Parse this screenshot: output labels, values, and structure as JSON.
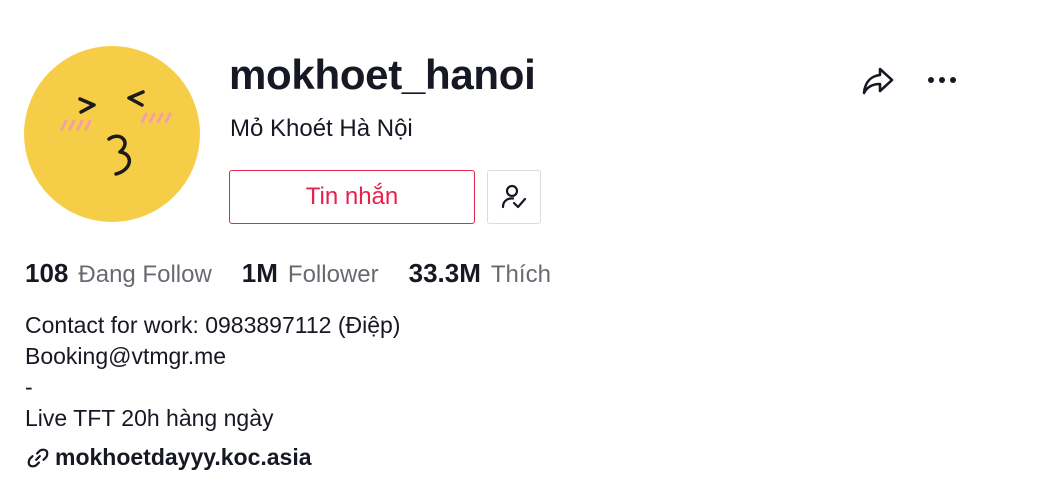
{
  "profile": {
    "username": "mokhoet_hanoi",
    "nickname": "Mỏ Khoét Hà Nội",
    "avatar_color": "#f6cd46"
  },
  "actions": {
    "message_label": "Tin nhắn",
    "accent_color": "#e8214b",
    "follow_icon": "user-check-icon",
    "share_icon": "share-icon",
    "more_icon": "more-dots-icon"
  },
  "stats": [
    {
      "value": "108",
      "label": "Đang Follow"
    },
    {
      "value": "1M",
      "label": "Follower"
    },
    {
      "value": "33.3M",
      "label": "Thích"
    }
  ],
  "bio": {
    "lines": [
      "Contact for work: 0983897112 (Điệp)",
      "Booking@vtmgr.me",
      "-",
      "Live TFT 20h hàng ngày"
    ]
  },
  "link": {
    "text": "mokhoetdayyy.koc.asia",
    "icon": "link-icon"
  }
}
